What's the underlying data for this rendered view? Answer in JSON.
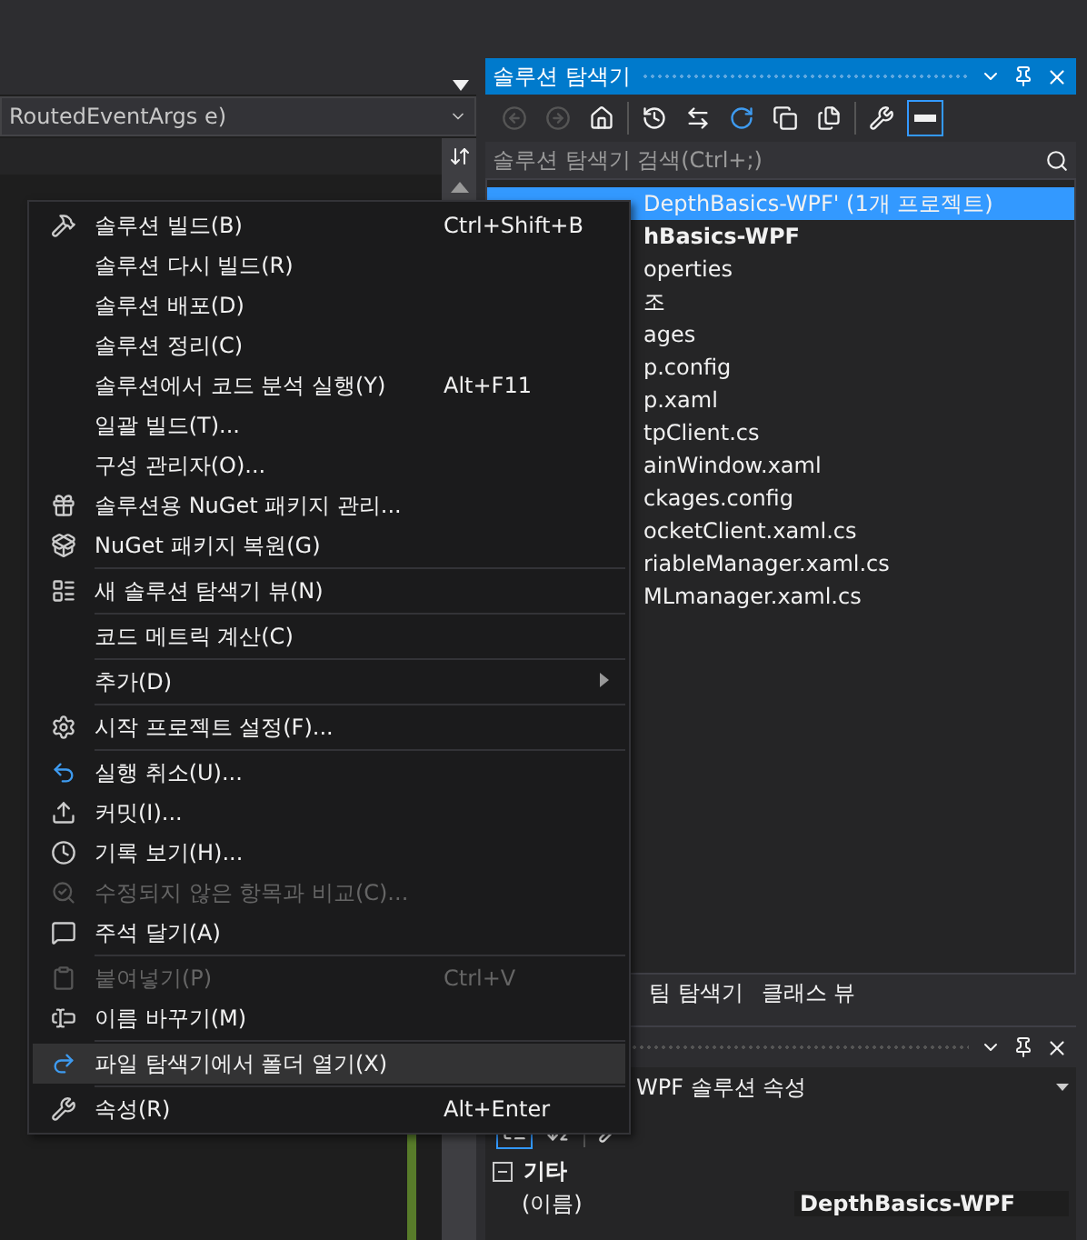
{
  "editor": {
    "member_combo": "RoutedEventArgs e)"
  },
  "solution_explorer": {
    "title": "솔루션 탐색기",
    "search": {
      "placeholder": "솔루션 탐색기 검색(Ctrl+;)"
    },
    "tree": [
      {
        "label": "DepthBasics-WPF' (1개 프로젝트)",
        "selected": true,
        "bold": false
      },
      {
        "label": "hBasics-WPF",
        "selected": false,
        "bold": true
      },
      {
        "label": "operties",
        "selected": false,
        "bold": false
      },
      {
        "label": "조",
        "selected": false,
        "bold": false
      },
      {
        "label": "ages",
        "selected": false,
        "bold": false
      },
      {
        "label": "p.config",
        "selected": false,
        "bold": false
      },
      {
        "label": "p.xaml",
        "selected": false,
        "bold": false
      },
      {
        "label": "tpClient.cs",
        "selected": false,
        "bold": false
      },
      {
        "label": "ainWindow.xaml",
        "selected": false,
        "bold": false
      },
      {
        "label": "ckages.config",
        "selected": false,
        "bold": false
      },
      {
        "label": "ocketClient.xaml.cs",
        "selected": false,
        "bold": false
      },
      {
        "label": "riableManager.xaml.cs",
        "selected": false,
        "bold": false
      },
      {
        "label": "MLmanager.xaml.cs",
        "selected": false,
        "bold": false
      }
    ]
  },
  "bottom_tabs": [
    {
      "label": "팀 탐색기",
      "selected": false
    },
    {
      "label": "클래스 뷰",
      "selected": false
    }
  ],
  "properties": {
    "object": "WPF 솔루션 속성",
    "category": "기타",
    "rows": [
      {
        "name": "(이름)",
        "value": "DepthBasics-WPF"
      }
    ]
  },
  "context_menu": {
    "items": [
      {
        "kind": "item",
        "label": "솔루션 빌드(B)",
        "shortcut": "Ctrl+Shift+B",
        "disabled": false,
        "selected": false
      },
      {
        "kind": "item",
        "label": "솔루션 다시 빌드(R)",
        "disabled": false,
        "selected": false
      },
      {
        "kind": "item",
        "label": "솔루션 배포(D)",
        "disabled": false,
        "selected": false
      },
      {
        "kind": "item",
        "label": "솔루션 정리(C)",
        "disabled": false,
        "selected": false
      },
      {
        "kind": "item",
        "label": "솔루션에서 코드 분석 실행(Y)",
        "shortcut": "Alt+F11",
        "disabled": false,
        "selected": false
      },
      {
        "kind": "item",
        "label": "일괄 빌드(T)...",
        "disabled": false,
        "selected": false
      },
      {
        "kind": "item",
        "label": "구성 관리자(O)...",
        "disabled": false,
        "selected": false
      },
      {
        "kind": "item",
        "label": "솔루션용 NuGet 패키지 관리...",
        "disabled": false,
        "selected": false
      },
      {
        "kind": "item",
        "label": "NuGet 패키지 복원(G)",
        "disabled": false,
        "selected": false
      },
      {
        "kind": "separator"
      },
      {
        "kind": "item",
        "label": "새 솔루션 탐색기 뷰(N)",
        "disabled": false,
        "selected": false
      },
      {
        "kind": "separator"
      },
      {
        "kind": "item",
        "label": "코드 메트릭 계산(C)",
        "disabled": false,
        "selected": false
      },
      {
        "kind": "separator"
      },
      {
        "kind": "submenu",
        "label": "추가(D)",
        "disabled": false,
        "selected": false
      },
      {
        "kind": "separator"
      },
      {
        "kind": "item",
        "label": "시작 프로젝트 설정(F)...",
        "disabled": false,
        "selected": false
      },
      {
        "kind": "separator"
      },
      {
        "kind": "item",
        "label": "실행 취소(U)...",
        "disabled": false,
        "selected": false
      },
      {
        "kind": "item",
        "label": "커밋(I)...",
        "disabled": false,
        "selected": false
      },
      {
        "kind": "item",
        "label": "기록 보기(H)...",
        "disabled": false,
        "selected": false
      },
      {
        "kind": "item",
        "label": "수정되지 않은 항목과 비교(C)...",
        "disabled": true,
        "selected": false
      },
      {
        "kind": "item",
        "label": "주석 달기(A)",
        "disabled": false,
        "selected": false
      },
      {
        "kind": "separator"
      },
      {
        "kind": "item",
        "label": "붙여넣기(P)",
        "shortcut": "Ctrl+V",
        "disabled": true,
        "selected": false
      },
      {
        "kind": "item",
        "label": "이름 바꾸기(M)",
        "disabled": false,
        "selected": false
      },
      {
        "kind": "separator"
      },
      {
        "kind": "item",
        "label": "파일 탐색기에서 폴더 열기(X)",
        "disabled": false,
        "selected": true
      },
      {
        "kind": "separator"
      },
      {
        "kind": "item",
        "label": "속성(R)",
        "shortcut": "Alt+Enter",
        "disabled": false,
        "selected": false
      }
    ]
  }
}
